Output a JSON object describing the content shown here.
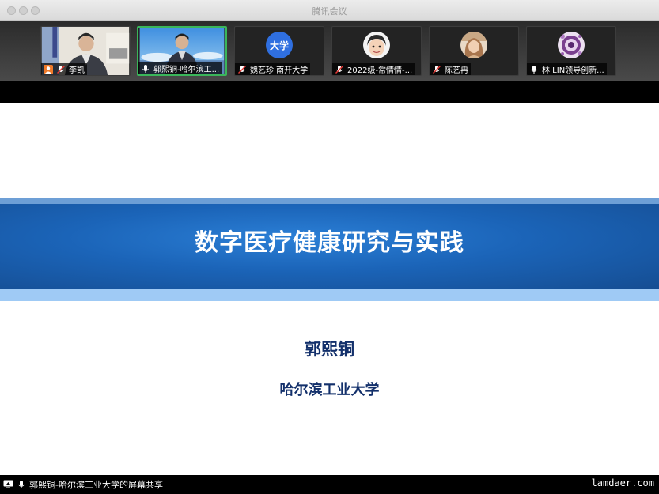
{
  "window": {
    "title": "腾讯会议"
  },
  "participants": [
    {
      "name": "李凯",
      "mic": "muted",
      "view": "video"
    },
    {
      "name": "郭熙铜-哈尔滨工...",
      "mic": "on",
      "view": "video",
      "active": true
    },
    {
      "name": "魏艺珍 南开大学",
      "mic": "muted",
      "view": "avatar",
      "avatar_text": "大学"
    },
    {
      "name": "2022级-常情情-...",
      "mic": "muted",
      "view": "avatar"
    },
    {
      "name": "陈艺冉",
      "mic": "muted",
      "view": "avatar"
    },
    {
      "name": "林 LIN领导创新...",
      "mic": "on",
      "view": "avatar"
    }
  ],
  "slide": {
    "title": "数字医疗健康研究与实践",
    "presenter": "郭熙铜",
    "affiliation": "哈尔滨工业大学"
  },
  "status_bar": {
    "share_label": "郭熙铜-哈尔滨工业大学的屏幕共享"
  },
  "watermark": "lamdaer.com",
  "colors": {
    "slide_band": "#1b64b8",
    "text_dark_blue": "#13306b",
    "active_border": "#3ab65a"
  }
}
